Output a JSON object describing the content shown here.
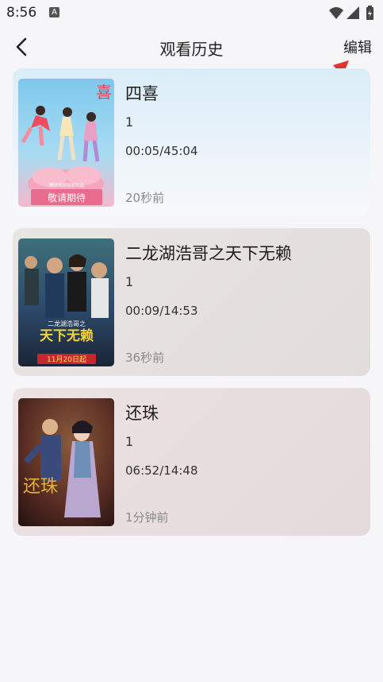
{
  "status_bar": {
    "time": "8:56",
    "notification_glyph": "A",
    "icons": [
      "wifi-icon",
      "signal-icon",
      "battery-icon"
    ]
  },
  "header": {
    "title": "观看历史",
    "edit_label": "编辑",
    "back_icon": "chevron-left-icon"
  },
  "annotation": {
    "color": "#e5322d"
  },
  "history": [
    {
      "title": "四喜",
      "episode": "1",
      "progress": "00:05/45:04",
      "watched": "20秒前",
      "poster_text": "敬请期待",
      "poster_subtext": "腾讯视频独家出品",
      "poster_mark": "喜"
    },
    {
      "title": "二龙湖浩哥之天下无赖",
      "episode": "1",
      "progress": "00:09/14:53",
      "watched": "36秒前",
      "poster_text": "天下无赖",
      "poster_subtext": "二龙湖浩哥之",
      "poster_date": "11月20日起"
    },
    {
      "title": "还珠",
      "episode": "1",
      "progress": "06:52/14:48",
      "watched": "1分钟前",
      "poster_text": "还珠"
    }
  ]
}
